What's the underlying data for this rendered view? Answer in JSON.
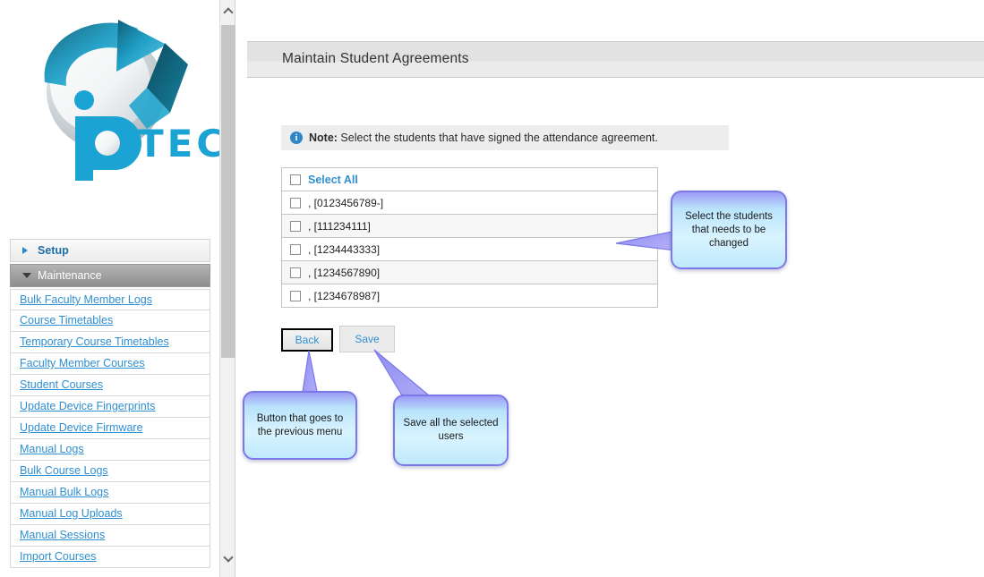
{
  "branding": {
    "logo_text": "TECH",
    "logo_alt": "iP TECH logo"
  },
  "sidebar": {
    "sections": [
      {
        "label": "Setup",
        "state": "collapsed",
        "icon": "chevron-right-icon"
      },
      {
        "label": "Maintenance",
        "state": "expanded",
        "icon": "chevron-down-icon"
      }
    ],
    "items": [
      {
        "label": "Bulk Faculty Member Logs"
      },
      {
        "label": "Course Timetables"
      },
      {
        "label": "Temporary Course Timetables"
      },
      {
        "label": "Faculty Member Courses"
      },
      {
        "label": "Student Courses"
      },
      {
        "label": "Update Device Fingerprints"
      },
      {
        "label": "Update Device Firmware"
      },
      {
        "label": "Manual Logs"
      },
      {
        "label": "Bulk Course Logs"
      },
      {
        "label": "Manual Bulk Logs"
      },
      {
        "label": "Manual Log Uploads"
      },
      {
        "label": "Manual Sessions"
      },
      {
        "label": "Import Courses"
      }
    ],
    "scrollbar": {
      "up_icon": "chevron-up-icon",
      "down_icon": "chevron-down-icon"
    }
  },
  "page": {
    "title": "Maintain Student Agreements"
  },
  "note": {
    "icon": "info-icon",
    "prefix": "Note:",
    "text": " Select the students that have signed the attendance agreement."
  },
  "table": {
    "select_all_label": "Select All",
    "rows": [
      {
        "label": ", [0123456789-]",
        "checked": false
      },
      {
        "label": ", [111234111]",
        "checked": false
      },
      {
        "label": ", [1234443333]",
        "checked": false
      },
      {
        "label": ", [1234567890]",
        "checked": false
      },
      {
        "label": ", [1234678987]",
        "checked": false
      }
    ]
  },
  "buttons": {
    "back": "Back",
    "save": "Save"
  },
  "callouts": {
    "select": "Select the students that needs to be changed",
    "back": "Button that goes to the previous menu",
    "save": "Save all the selected users"
  },
  "colors": {
    "link": "#2f8fd0",
    "accent": "#1ba3d3",
    "callout_border": "#7b78e8",
    "header_gray": "#e2e2e2",
    "active_section": "#8e8e8e"
  }
}
